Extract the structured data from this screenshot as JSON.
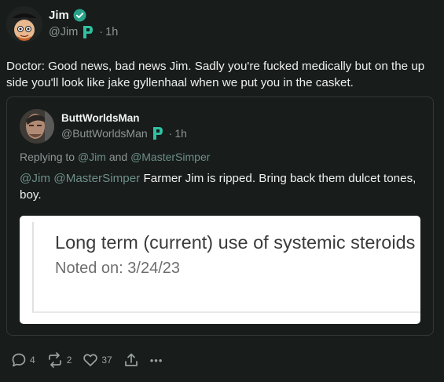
{
  "author": {
    "name": "Jim",
    "handle": "@Jim",
    "time": "1h"
  },
  "post": {
    "text": "Doctor: Good news, bad news Jim.  Sadly you're fucked medically but on the up side you'll look like jake gyllenhaal when we put you in the casket."
  },
  "quote": {
    "name": "ButtWorldsMan",
    "handle": "@ButtWorldsMan",
    "time": "1h",
    "replying_prefix": "Replying to",
    "replying_to_1": "@Jim",
    "replying_and": "and",
    "replying_to_2": "@MasterSimper",
    "mention_1": "@Jim",
    "mention_2": "@MasterSimper",
    "text": "Farmer Jim is ripped. Bring back them dulcet tones, boy.",
    "image": {
      "title": "Long term (current) use of systemic steroids",
      "subtitle": "Noted on: 3/24/23"
    }
  },
  "actions": {
    "replies": "4",
    "reposts": "2",
    "likes": "37",
    "more": "•••"
  },
  "colors": {
    "background": "#181c1b",
    "muted": "#8d9795",
    "mention": "#6d8f87",
    "verified": "#28a38a"
  }
}
